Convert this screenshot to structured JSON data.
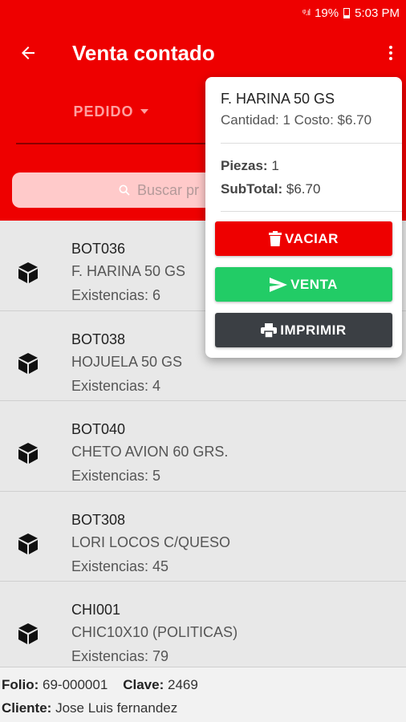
{
  "status": {
    "signal": "ᵠ.ıl",
    "battery": "19%",
    "time": "5:03 PM"
  },
  "app_bar": {
    "title": "Venta contado"
  },
  "tab": {
    "label": "PEDIDO"
  },
  "search": {
    "placeholder": "Buscar pr"
  },
  "products": [
    {
      "code": "BOT036",
      "name": "F. HARINA 50 GS",
      "stock": "Existencias: 6"
    },
    {
      "code": "BOT038",
      "name": "HOJUELA 50 GS",
      "stock": "Existencias: 4"
    },
    {
      "code": "BOT040",
      "name": "CHETO AVION 60 GRS.",
      "stock": "Existencias: 5"
    },
    {
      "code": "BOT308",
      "name": "LORI LOCOS C/QUESO",
      "stock": "Existencias: 45"
    },
    {
      "code": "CHI001",
      "name": "CHIC10X10 (POLITICAS)",
      "stock": "Existencias: 79"
    }
  ],
  "footer": {
    "folio_label": "Folio:",
    "folio_value": "69-000001",
    "clave_label": "Clave:",
    "clave_value": "2469",
    "cliente_label": "Cliente:",
    "cliente_value": "Jose Luis fernandez"
  },
  "popup": {
    "item_name": "F. HARINA 50 GS",
    "qty_line": "Cantidad: 1 Costo: $6.70",
    "piezas_label": "Piezas:",
    "piezas_value": "1",
    "subtotal_label": "SubTotal:",
    "subtotal_value": "$6.70",
    "vaciar": "VACIAR",
    "venta": "VENTA",
    "imprimir": "IMPRIMIR"
  },
  "colors": {
    "primary": "#ee0000",
    "success": "#22cc66",
    "dark": "#3b3f44"
  },
  "icons": {
    "back": "arrow-left-icon",
    "menu": "more-vert-icon",
    "search": "search-icon",
    "product": "cube-icon",
    "trash": "trash-icon",
    "send": "send-icon",
    "print": "printer-icon"
  }
}
